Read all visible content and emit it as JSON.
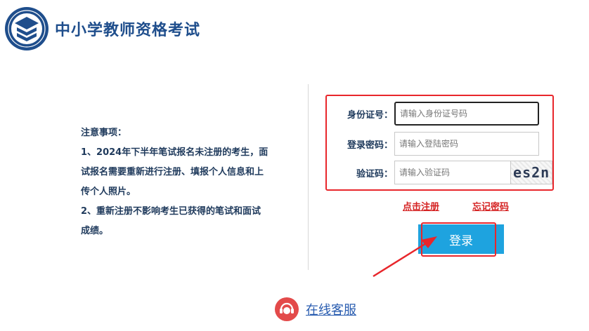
{
  "header": {
    "title": "中小学教师资格考试"
  },
  "notice": {
    "title": "注意事项：",
    "lines": [
      "1、2024年下半年笔试报名未注册的考生，面",
      "试报名需要重新进行注册、填报个人信息和上",
      "传个人照片。",
      "2、重新注册不影响考生已获得的笔试和面试",
      "成绩。"
    ]
  },
  "form": {
    "id_label": "身份证号：",
    "id_placeholder": "请输入身份证号码",
    "password_label": "登录密码：",
    "password_placeholder": "请输入登陆密码",
    "captcha_label": "验证码：",
    "captcha_placeholder": "请输入验证码",
    "captcha_text": "es2n"
  },
  "links": {
    "register": "点击注册",
    "forgot": "忘记密码"
  },
  "login_label": "登录",
  "service_label": "在线客服",
  "colors": {
    "brand": "#1f4e8c",
    "button": "#1ea3df",
    "highlight": "#e8262b",
    "link_red": "#d52222"
  }
}
